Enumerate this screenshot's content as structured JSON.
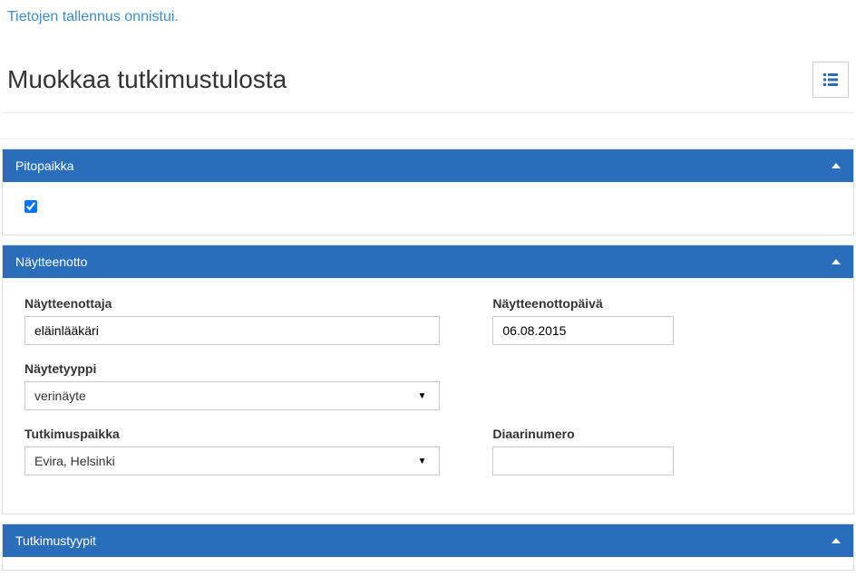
{
  "status_message": "Tietojen tallennus onnistui.",
  "page_title": "Muokkaa tutkimustulosta",
  "icons": {
    "list_button": "list-icon"
  },
  "panels": {
    "location": {
      "title": "Pitopaikka",
      "item_checked": true,
      "item_label": ""
    },
    "sampling": {
      "title": "Näytteenotto",
      "fields": {
        "sampler_label": "Näytteenottaja",
        "sampler_value": "eläinlääkäri",
        "sample_date_label": "Näytteenottopäivä",
        "sample_date_value": "06.08.2015",
        "sample_type_label": "Näytetyyppi",
        "sample_type_value": "verinäyte",
        "research_place_label": "Tutkimuspaikka",
        "research_place_value": "Evira, Helsinki",
        "diary_number_label": "Diaarinumero",
        "diary_number_value": ""
      }
    },
    "research_types": {
      "title": "Tutkimustyypit"
    }
  }
}
